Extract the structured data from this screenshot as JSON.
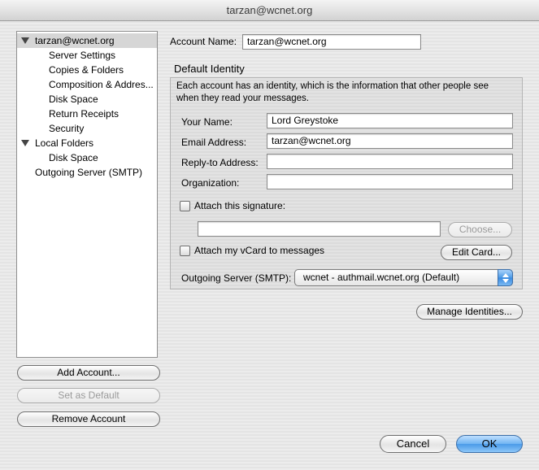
{
  "window": {
    "title": "tarzan@wcnet.org"
  },
  "tree": {
    "items": [
      {
        "label": "tarzan@wcnet.org",
        "level": 0,
        "expanded": true,
        "selected": true
      },
      {
        "label": "Server Settings",
        "level": 1
      },
      {
        "label": "Copies & Folders",
        "level": 1
      },
      {
        "label": "Composition & Addres...",
        "level": 1
      },
      {
        "label": "Disk Space",
        "level": 1
      },
      {
        "label": "Return Receipts",
        "level": 1
      },
      {
        "label": "Security",
        "level": 1
      },
      {
        "label": "Local Folders",
        "level": 0,
        "expanded": true
      },
      {
        "label": "Disk Space",
        "level": 1
      },
      {
        "label": "Outgoing Server (SMTP)",
        "level": 0
      }
    ]
  },
  "left_buttons": {
    "add_account": "Add Account...",
    "set_default": "Set as Default",
    "remove_account": "Remove Account"
  },
  "account": {
    "name_label": "Account Name:",
    "name_value": "tarzan@wcnet.org"
  },
  "identity": {
    "heading": "Default Identity",
    "description": "Each account has an identity, which is the information that other people see when they read your messages.",
    "your_name_label": "Your Name:",
    "your_name_value": "Lord Greystoke",
    "email_label": "Email Address:",
    "email_value": "tarzan@wcnet.org",
    "reply_to_label": "Reply-to Address:",
    "reply_to_value": "",
    "organization_label": "Organization:",
    "organization_value": "",
    "attach_signature_label": "Attach this signature:",
    "signature_path": "",
    "choose_button": "Choose...",
    "attach_vcard_label": "Attach my vCard to messages",
    "edit_card_button": "Edit Card...",
    "smtp_label": "Outgoing Server (SMTP):",
    "smtp_value": "wcnet - authmail.wcnet.org (Default)"
  },
  "manage_identities_button": "Manage Identities...",
  "dialog_buttons": {
    "cancel": "Cancel",
    "ok": "OK"
  },
  "colors": {
    "ok_button": "#5fa8ef",
    "selection": "#d6d6d6"
  }
}
